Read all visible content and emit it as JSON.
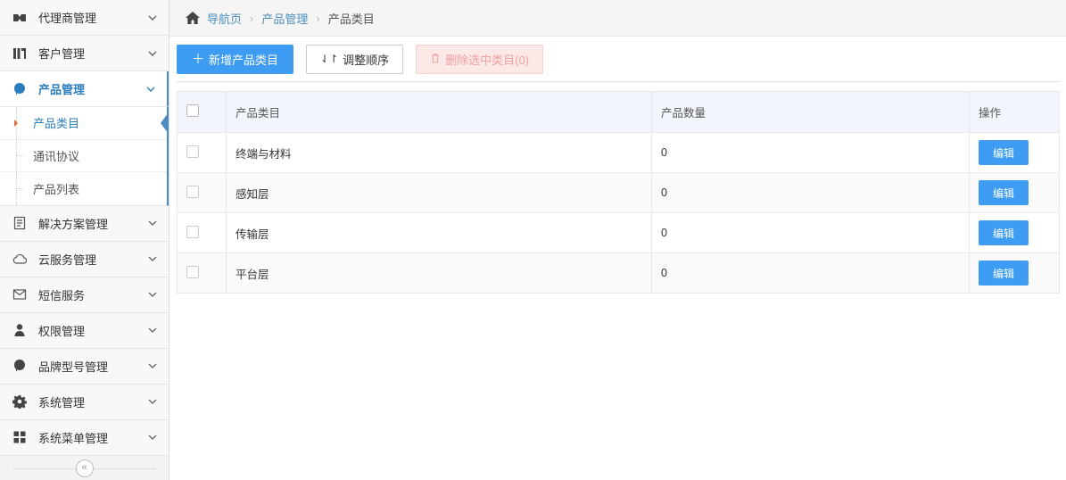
{
  "sidebar": {
    "items": [
      {
        "label": "代理商管理",
        "icon": "agent-icon"
      },
      {
        "label": "客户管理",
        "icon": "customers-icon"
      },
      {
        "label": "产品管理",
        "icon": "product-icon",
        "active": true
      },
      {
        "label": "解决方案管理",
        "icon": "document-icon"
      },
      {
        "label": "云服务管理",
        "icon": "cloud-icon"
      },
      {
        "label": "短信服务",
        "icon": "envelope-icon"
      },
      {
        "label": "权限管理",
        "icon": "user-icon"
      },
      {
        "label": "品牌型号管理",
        "icon": "brand-icon"
      },
      {
        "label": "系统管理",
        "icon": "gear-icon"
      },
      {
        "label": "系统菜单管理",
        "icon": "grid-icon"
      }
    ],
    "submenu": [
      {
        "label": "产品类目",
        "active": true
      },
      {
        "label": "通讯协议"
      },
      {
        "label": "产品列表"
      }
    ],
    "collapse_glyph": "«"
  },
  "breadcrumb": {
    "home": "导航页",
    "level1": "产品管理",
    "current": "产品类目"
  },
  "toolbar": {
    "add_label": "新增产品类目",
    "reorder_label": "调整顺序",
    "delete_label": "删除选中类目(0)"
  },
  "table": {
    "headers": [
      "产品类目",
      "产品数量",
      "操作"
    ],
    "edit_label": "编辑",
    "rows": [
      {
        "name": "终端与材料",
        "count": "0"
      },
      {
        "name": "感知层",
        "count": "0"
      },
      {
        "name": "传输层",
        "count": "0"
      },
      {
        "name": "平台层",
        "count": "0"
      }
    ]
  },
  "colors": {
    "primary": "#3e9df3",
    "active_text": "#2b7dbc",
    "link": "#4c8fbd",
    "sidebar_border": "#4a8bc2"
  }
}
